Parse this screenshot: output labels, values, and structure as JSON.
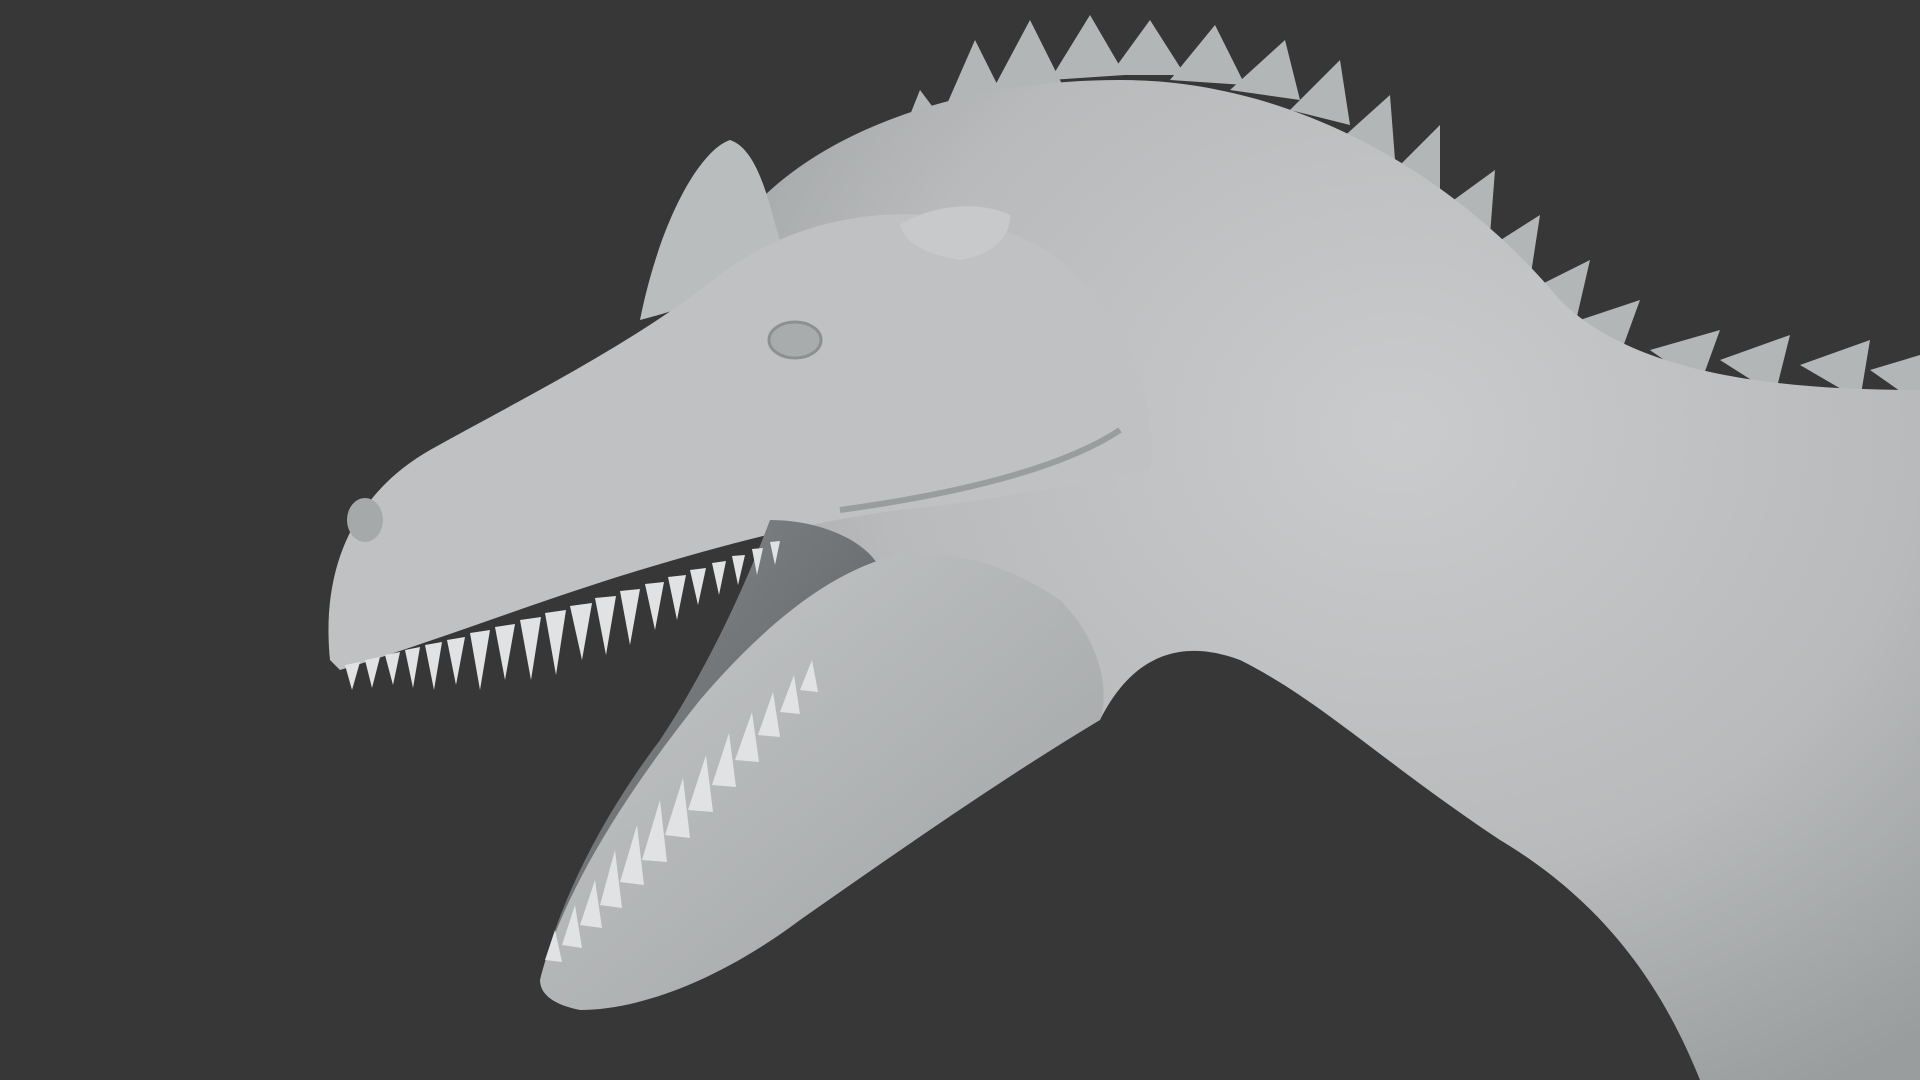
{
  "scene": {
    "subject": "dinosaur-head-model",
    "shading": "clay",
    "background_color": "#373737",
    "model_color": "#b9bcbd",
    "highlight_color": "#d6d8d9",
    "shadow_color": "#7e8182",
    "mouth_interior_color": "#5b5e60"
  }
}
